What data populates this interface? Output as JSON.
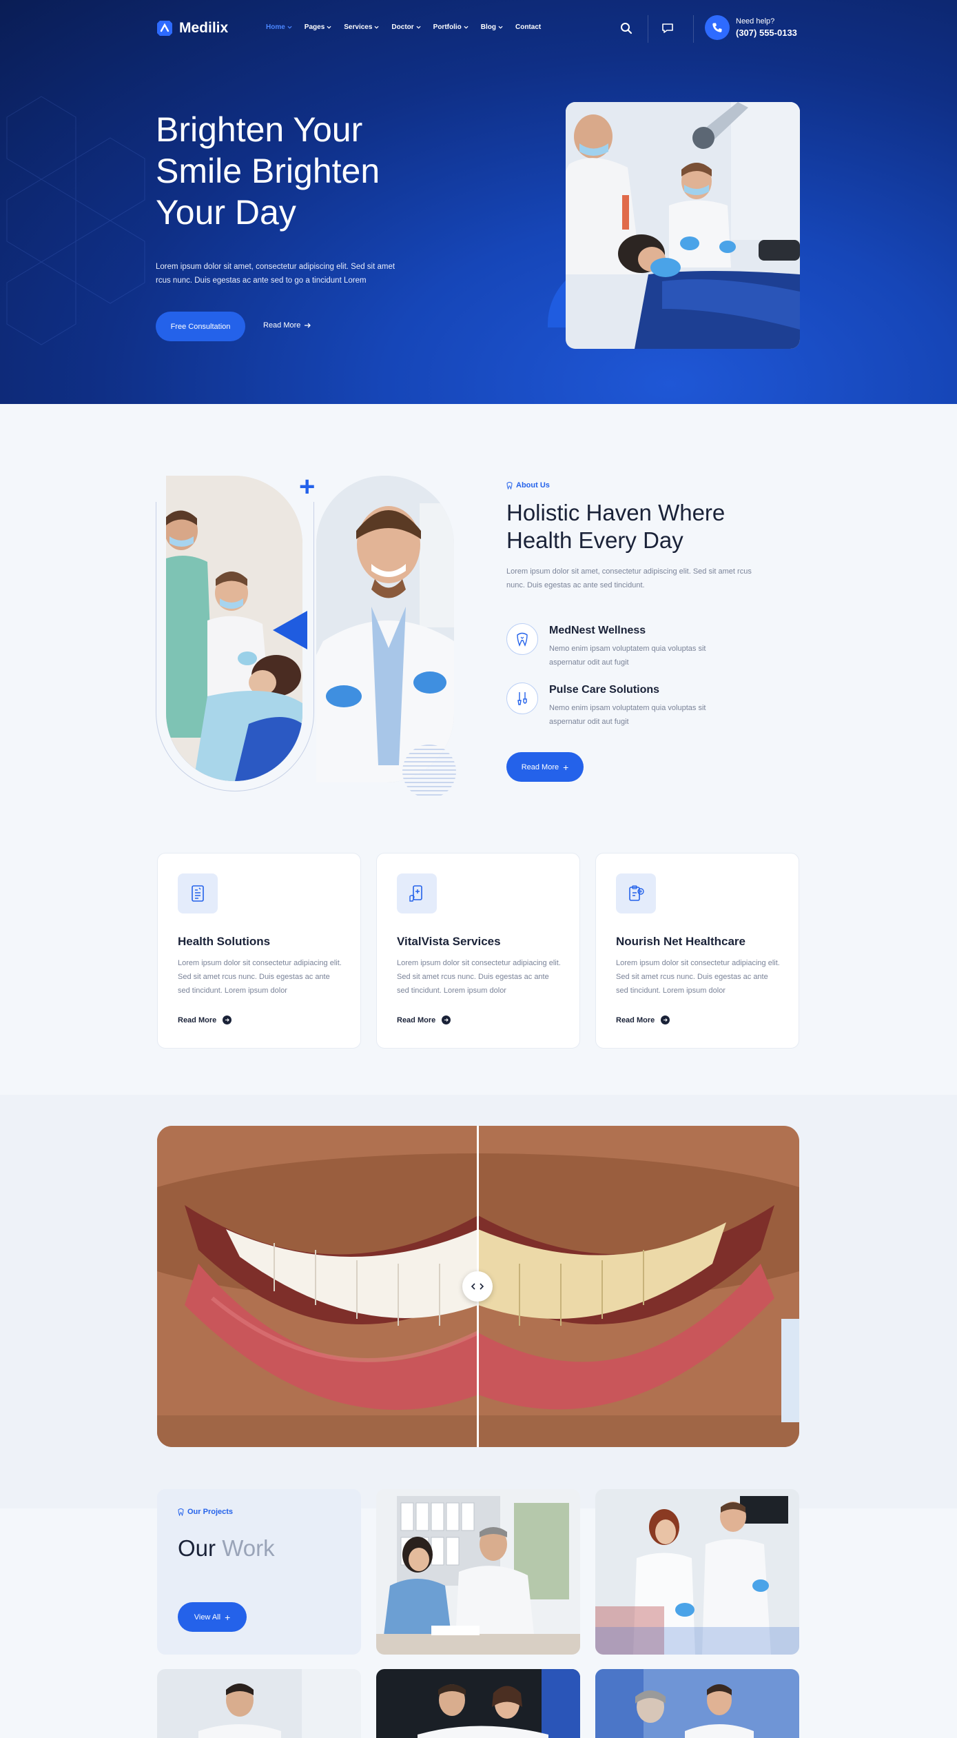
{
  "brand": {
    "name": "Medilix",
    "accent": "#2462ea",
    "hero_dark": "#0a1d55"
  },
  "nav": {
    "items": [
      {
        "label": "Home",
        "active": true
      },
      {
        "label": "Pages"
      },
      {
        "label": "Services"
      },
      {
        "label": "Doctor"
      },
      {
        "label": "Portfolio"
      },
      {
        "label": "Blog"
      },
      {
        "label": "Contact"
      }
    ],
    "help_label": "Need help?",
    "help_phone": "(307) 555-0133",
    "icons": [
      "search-icon",
      "chat-icon",
      "phone-icon"
    ]
  },
  "hero": {
    "title": "Brighten Your Smile Brighten Your Day",
    "description": "Lorem ipsum dolor sit amet, consectetur adipiscing elit. Sed sit amet rcus nunc. Duis egestas ac ante sed to go a tincidunt Lorem",
    "primary_button": "Free Consultation",
    "secondary_link": "Read More"
  },
  "about": {
    "eyebrow": "About Us",
    "title": "Holistic Haven Where Health Every Day",
    "description": "Lorem ipsum dolor sit amet, consectetur adipiscing elit. Sed sit amet rcus nunc. Duis egestas ac ante sed tincidunt.",
    "features": [
      {
        "title": "MedNest Wellness",
        "description": "Nemo enim ipsam voluptatem quia voluptas sit aspernatur odit aut fugit",
        "icon": "tooth-icon"
      },
      {
        "title": "Pulse Care Solutions",
        "description": "Nemo enim ipsam voluptatem quia voluptas sit aspernatur odit aut fugit",
        "icon": "dental-tools-icon"
      }
    ],
    "button": "Read More"
  },
  "services": [
    {
      "title": "Health Solutions",
      "description": "Lorem ipsum dolor sit consectetur adipiacing elit. Sed sit amet rcus nunc. Duis egestas ac ante sed tincidunt. Lorem ipsum dolor",
      "link": "Read More",
      "icon": "medical-report-icon"
    },
    {
      "title": "VitalVista Services",
      "description": "Lorem ipsum dolor sit consectetur adipiacing elit. Sed sit amet rcus nunc. Duis egestas ac ante sed tincidunt. Lorem ipsum dolor",
      "link": "Read More",
      "icon": "medical-phone-icon"
    },
    {
      "title": "Nourish Net Healthcare",
      "description": "Lorem ipsum dolor sit consectetur adipiacing elit. Sed sit amet rcus nunc. Duis egestas ac ante sed tincidunt. Lorem ipsum dolor",
      "link": "Read More",
      "icon": "prescription-icon"
    }
  ],
  "comparison": {
    "handle_icon": "left-right-arrows-icon"
  },
  "projects": {
    "eyebrow": "Our Projects",
    "title_dark": "Our",
    "title_light": "Work",
    "button": "View All"
  }
}
